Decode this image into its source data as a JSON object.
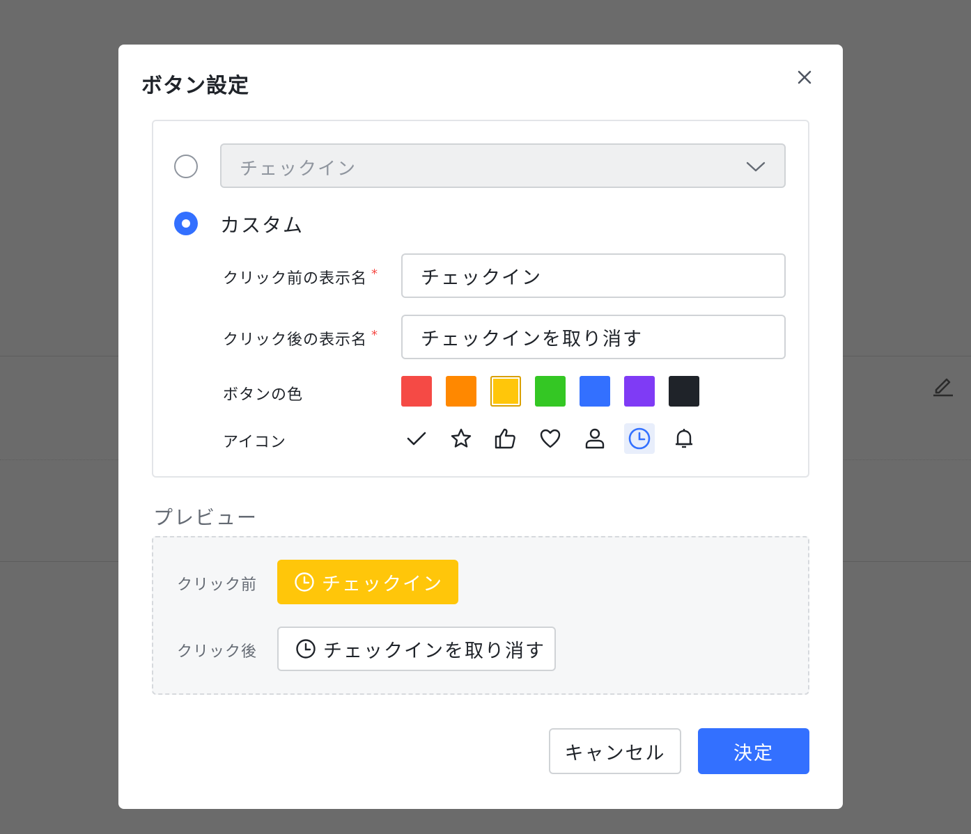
{
  "modal": {
    "title": "ボタン設定",
    "close_icon": "close-icon"
  },
  "options": {
    "preset": {
      "selected": false,
      "value": "チェックイン"
    },
    "custom": {
      "selected": true,
      "label": "カスタム"
    }
  },
  "form": {
    "before_label": "クリック前の表示名",
    "before_value": "チェックイン",
    "after_label": "クリック後の表示名",
    "after_value": "チェックインを取り消す",
    "required_mark": "*",
    "color_label": "ボタンの色",
    "icon_label": "アイコン"
  },
  "colors": [
    {
      "name": "red",
      "hex": "#f54a45",
      "selected": false
    },
    {
      "name": "orange",
      "hex": "#ff8800",
      "selected": false
    },
    {
      "name": "yellow",
      "hex": "#ffc60a",
      "selected": true
    },
    {
      "name": "green",
      "hex": "#34c724",
      "selected": false
    },
    {
      "name": "blue",
      "hex": "#3370ff",
      "selected": false
    },
    {
      "name": "purple",
      "hex": "#7f3bf5",
      "selected": false
    },
    {
      "name": "black",
      "hex": "#1f2329",
      "selected": false
    }
  ],
  "icons": [
    {
      "name": "check-icon",
      "selected": false
    },
    {
      "name": "star-icon",
      "selected": false
    },
    {
      "name": "thumbs-up-icon",
      "selected": false
    },
    {
      "name": "heart-icon",
      "selected": false
    },
    {
      "name": "person-icon",
      "selected": false
    },
    {
      "name": "clock-icon",
      "selected": true
    },
    {
      "name": "bell-icon",
      "selected": false
    }
  ],
  "preview": {
    "title": "プレビュー",
    "before_label": "クリック前",
    "before_button": "チェックイン",
    "after_label": "クリック後",
    "after_button": "チェックインを取り消す"
  },
  "footer": {
    "cancel": "キャンセル",
    "ok": "決定"
  },
  "theme": {
    "accent": "#3370ff",
    "required": "#f54a45",
    "preview_button": "#ffc60a"
  }
}
